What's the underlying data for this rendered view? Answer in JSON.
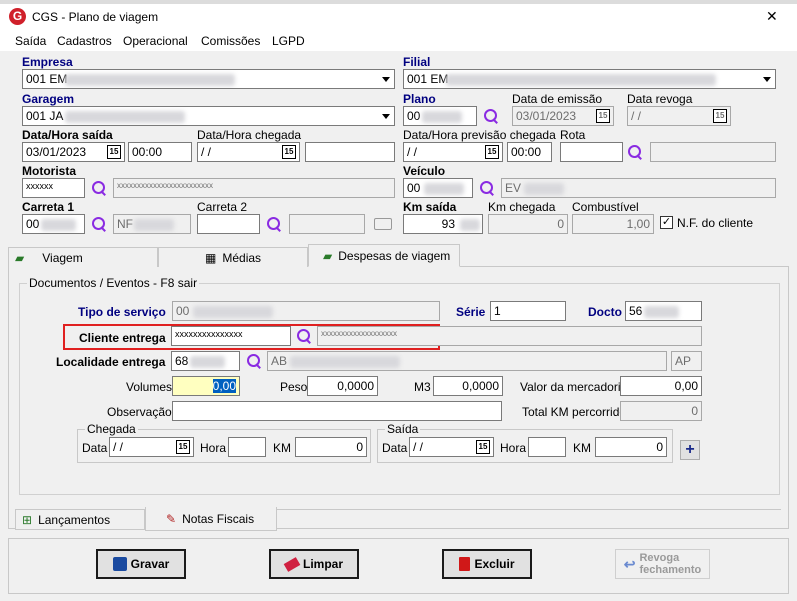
{
  "window": {
    "title": "CGS - Plano de viagem",
    "close": "✕"
  },
  "menu": [
    "Saída",
    "Cadastros",
    "Operacional",
    "Comissões",
    "LGPD"
  ],
  "header": {
    "empresa_label": "Empresa",
    "empresa_value": "001 EM",
    "filial_label": "Filial",
    "filial_value": "001 EM",
    "garagem_label": "Garagem",
    "garagem_value": "001 JA",
    "plano_label": "Plano",
    "plano_value": "00",
    "emissao_label": "Data de emissão",
    "emissao_value": "03/01/2023",
    "revoga_label": "Data revoga",
    "revoga_value": " / /",
    "saida_label": "Data/Hora saída",
    "saida_date": "03/01/2023",
    "saida_hora": "00:00",
    "chegada_label": "Data/Hora chegada",
    "chegada_date": " / /",
    "prev_label": "Data/Hora previsão chegada",
    "prev_date": " / /",
    "prev_hora": "00:00",
    "rota_label": "Rota",
    "motorista_label": "Motorista",
    "motorista_value": "xxxxxx",
    "motorista_desc": "xxxxxxxxxxxxxxxxxxxxxxxx",
    "veiculo_label": "Veículo",
    "veiculo_value": "00",
    "veiculo_desc": "EV",
    "carreta1_label": "Carreta 1",
    "carreta1_value": "00",
    "carreta1_desc": "NF",
    "carreta2_label": "Carreta 2",
    "kmsaida_label": "Km saída",
    "kmsaida_value": "93",
    "kmchegada_label": "Km chegada",
    "kmchegada_value": "0",
    "comb_label": "Combustível",
    "comb_value": "1,00",
    "nf_label": "N.F. do cliente"
  },
  "tabs": [
    "Viagem",
    "Médias",
    "Despesas de viagem"
  ],
  "docs": {
    "group_title": "Documentos / Eventos - F8 sair",
    "tipo_label": "Tipo de serviço",
    "tipo_value": "00",
    "serie_label": "Série",
    "serie_value": "1",
    "docto_label": "Docto",
    "docto_value": "56",
    "cliente_label": "Cliente entrega",
    "cliente_value": "xxxxxxxxxxxxxxx",
    "cliente_desc": "xxxxxxxxxxxxxxxxxxx",
    "localidade_label": "Localidade entrega",
    "localidade_value": "68",
    "localidade_desc": "AB",
    "localidade_uf": "AP",
    "volumes_label": "Volumes",
    "volumes_value": "0,00",
    "peso_label": "Peso",
    "peso_value": "0,0000",
    "m3_label": "M3",
    "m3_value": "0,0000",
    "valor_label": "Valor da mercadoria",
    "valor_value": "0,00",
    "obs_label": "Observação",
    "totalkm_label": "Total KM percorrido",
    "totalkm_value": "0",
    "chegada_title": "Chegada",
    "saida_title": "Saída",
    "data_label": "Data",
    "hora_label": "Hora",
    "km_label": "KM",
    "date_empty": " / /",
    "km_zero": "0"
  },
  "bottom_tabs": [
    "Lançamentos",
    "Notas Fiscais"
  ],
  "buttons": {
    "gravar": "Gravar",
    "limpar": "Limpar",
    "excluir": "Excluir",
    "revoga": "Revoga\nfechamento"
  },
  "colors": {
    "label_blue": "#000080",
    "highlight": "#e02020",
    "volumes_bg": "#ffffc0"
  }
}
